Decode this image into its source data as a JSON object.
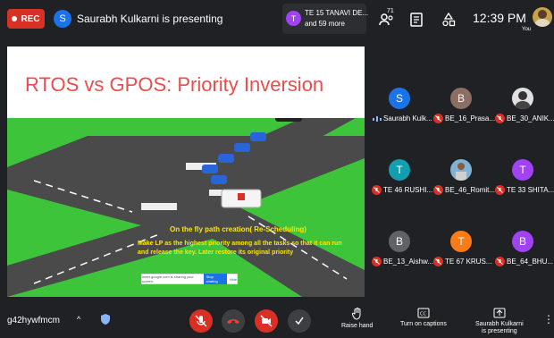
{
  "topbar": {
    "rec_label": "REC",
    "presenter_initial": "S",
    "presenter_text": "Saurabh Kulkarni is presenting",
    "others_initial": "T",
    "others_line1": "TE 15 TANAVI DE...",
    "others_line2": "and 59 more",
    "participants_count": "71",
    "clock": "12:39 PM",
    "you_label": "You"
  },
  "slide": {
    "title": "RTOS vs GPOS: Priority Inversion",
    "caption1": "On the fly path creation( Re-Scheduling)",
    "caption2": "Make LP as the highest priority among all the tasks so that it can run and release the key. Later restore its original priority",
    "share_text": "meet.google.com is sharing your screen.",
    "share_stop": "Stop sharing",
    "share_hide": "Hide"
  },
  "participants": [
    {
      "initial": "S",
      "name": "Saurabh Kulk...",
      "color": "#1a73e8",
      "muted": false
    },
    {
      "initial": "B",
      "name": "BE_16_Prasa...",
      "color": "#8d6e63",
      "muted": true
    },
    {
      "initial": "",
      "name": "BE_30_ANIK...",
      "color": "#e0e0e0",
      "muted": true
    },
    {
      "initial": "T",
      "name": "TE 46 RUSHI...",
      "color": "#129eaf",
      "muted": true
    },
    {
      "initial": "",
      "name": "BE_46_Romit...",
      "color": "#7fb3d5",
      "muted": true
    },
    {
      "initial": "T",
      "name": "TE 33 SHITA...",
      "color": "#a142f4",
      "muted": true
    },
    {
      "initial": "B",
      "name": "BE_13_Aishw...",
      "color": "#5f6368",
      "muted": true
    },
    {
      "initial": "T",
      "name": "TE 67 KRUS...",
      "color": "#fa7b17",
      "muted": true
    },
    {
      "initial": "B",
      "name": "BE_64_BHU...",
      "color": "#a142f4",
      "muted": true
    }
  ],
  "bottombar": {
    "meeting_code": "g42hywfmcm",
    "raise_hand": "Raise hand",
    "captions": "Turn on captions",
    "presenting_line1": "Saurabh Kulkarni",
    "presenting_line2": "is presenting"
  },
  "icons": {
    "mic_off": "mic-off-icon",
    "hang_up": "hang-up-icon",
    "camera_off": "camera-off-icon",
    "check": "check-icon"
  },
  "colors": {
    "danger": "#d93025",
    "accent": "#1a73e8",
    "title_red": "#e94d4d",
    "caption_yellow": "#ffe500"
  }
}
